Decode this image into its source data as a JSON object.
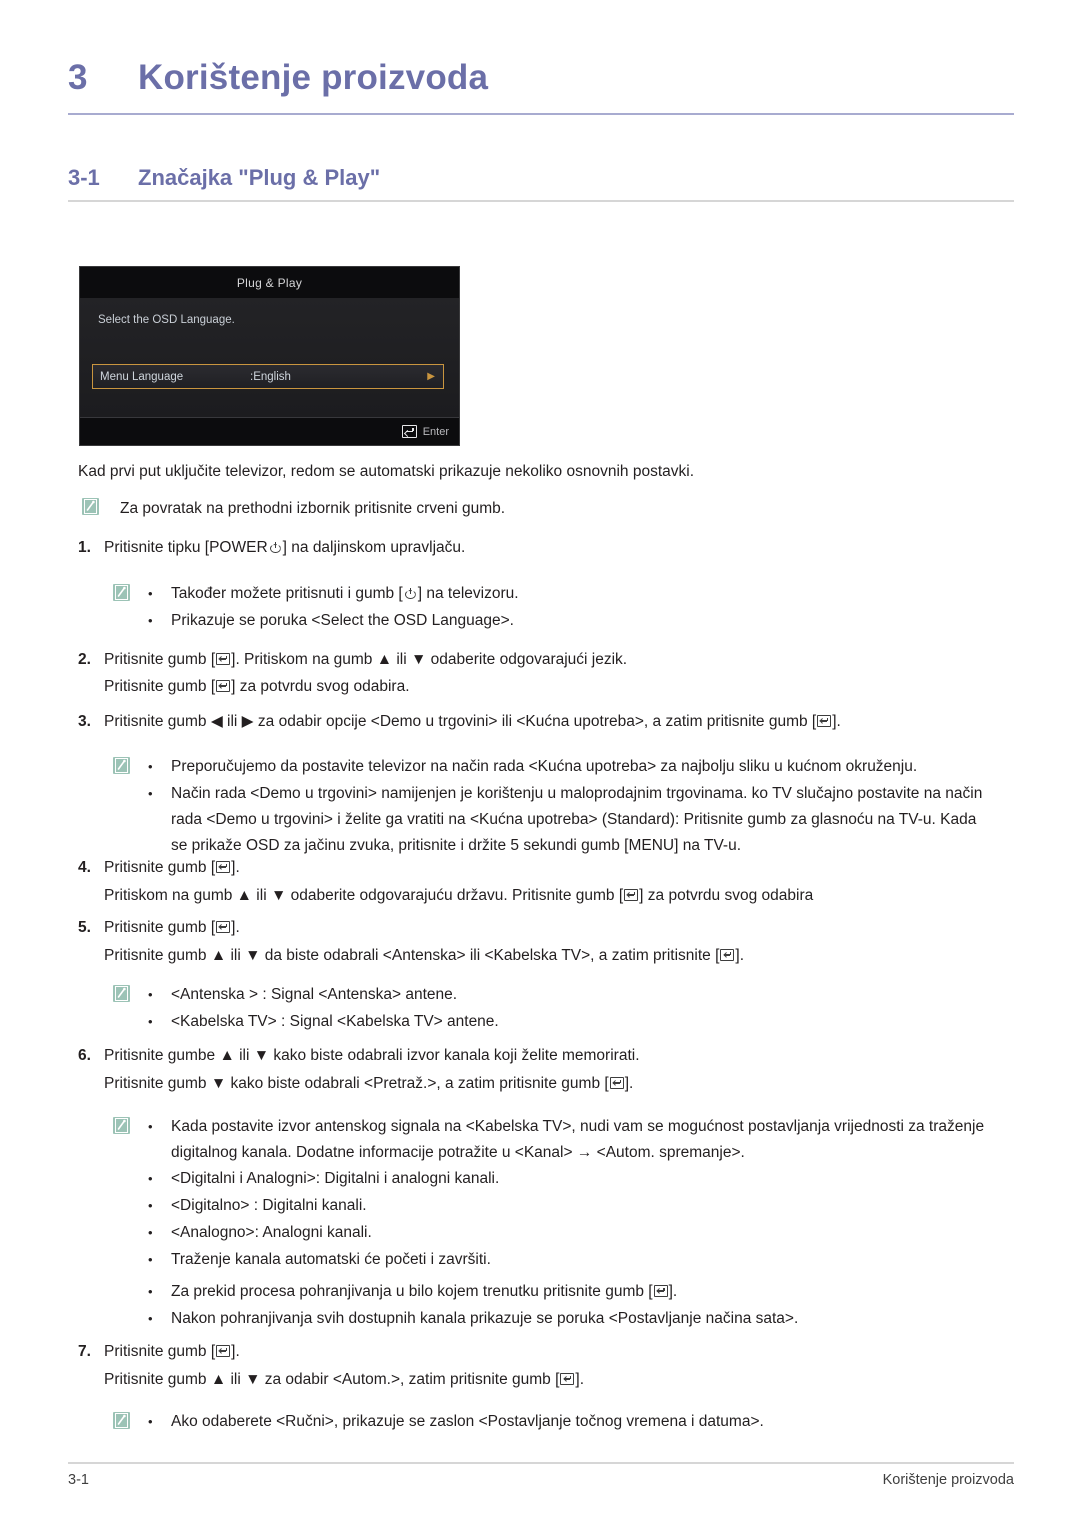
{
  "chapter": {
    "number": "3",
    "title": "Korištenje proizvoda"
  },
  "section": {
    "number": "3-1",
    "title": "Značajka \"Plug & Play\""
  },
  "osd": {
    "title": "Plug & Play",
    "prompt": "Select the OSD Language.",
    "row_label": "Menu Language",
    "row_value": ":English",
    "row_arrow": "▶",
    "enter_label": "Enter"
  },
  "intro": "Kad prvi put uključite televizor, redom se automatski prikazuje nekoliko osnovnih postavki.",
  "note_first": "Za povratak na prethodni izbornik pritisnite crveni gumb.",
  "steps": {
    "s1": {
      "num": "1.",
      "text_a": "Pritisnite tipku [POWER",
      "text_b": "] na daljinskom upravljaču.",
      "notes": [
        {
          "text_a": "Također možete pritisnuti i gumb [",
          "text_b": "] na televizoru."
        },
        {
          "text_a": "Prikazuje se poruka <Select the OSD Language>.",
          "text_b": ""
        }
      ]
    },
    "s2": {
      "num": "2.",
      "line1_a": "Pritisnite gumb [",
      "line1_b": "]. Pritiskom na gumb ▲ ili ▼ odaberite odgovarajući jezik.",
      "line2_a": "Pritisnite gumb [",
      "line2_b": "] za potvrdu svog odabira."
    },
    "s3": {
      "num": "3.",
      "text_a": "Pritisnite gumb ◀ ili ▶ za odabir opcije <Demo u trgovini> ili <Kućna upotreba>, a zatim pritisnite gumb [",
      "text_b": "].",
      "notes": [
        "Preporučujemo da postavite televizor na način rada <Kućna upotreba> za najbolju sliku u kućnom okruženju.",
        "Način rada <Demo u trgovini> namijenjen je korištenju u maloprodajnim trgovinama. ko TV slučajno postavite na način rada <Demo u trgovini> i želite ga vratiti na <Kućna upotreba> (Standard): Pritisnite gumb za glasnoću na TV-u. Kada se prikaže OSD za jačinu zvuka, pritisnite i držite 5 sekundi gumb [MENU] na TV-u."
      ]
    },
    "s4": {
      "num": "4.",
      "line1_a": "Pritisnite gumb [",
      "line1_b": "].",
      "line2_a": "Pritiskom na gumb ▲ ili ▼ odaberite odgovarajuću državu. Pritisnite gumb [",
      "line2_b": "] za potvrdu svog odabira"
    },
    "s5": {
      "num": "5.",
      "line1_a": "Pritisnite gumb [",
      "line1_b": "].",
      "line2_a": "Pritisnite gumb ▲ ili ▼ da biste odabrali <Antenska> ili <Kabelska TV>, a zatim pritisnite [",
      "line2_b": "].",
      "notes": [
        "<Antenska > : Signal <Antenska> antene.",
        "<Kabelska TV> : Signal <Kabelska TV> antene."
      ]
    },
    "s6": {
      "num": "6.",
      "line1": "Pritisnite gumbe ▲ ili ▼ kako biste odabrali izvor kanala koji želite memorirati.",
      "line2_a": "Pritisnite gumb ▼ kako biste odabrali <Pretraž.>, a zatim pritisnite gumb [",
      "line2_b": "].",
      "notes": [
        "Kada postavite izvor antenskog signala na <Kabelska TV>, nudi vam se mogućnost postavljanja vrijednosti za traženje digitalnog kanala. Dodatne informacije potražite u <Kanal> → <Autom. spremanje>.",
        "<Digitalni i Analogni>: Digitalni i analogni kanali.",
        "<Digitalno> : Digitalni kanali.",
        "<Analogno>: Analogni kanali.",
        "Traženje kanala automatski će početi i završiti."
      ],
      "note_enter_a": "Za prekid procesa pohranjivanja u bilo kojem trenutku pritisnite gumb [",
      "note_enter_b": "].",
      "note_last": "Nakon pohranjivanja svih dostupnih kanala prikazuje se poruka <Postavljanje načina sata>."
    },
    "s7": {
      "num": "7.",
      "line1_a": "Pritisnite gumb [",
      "line1_b": "].",
      "line2_a": "Pritisnite gumb ▲ ili ▼ za odabir <Autom.>, zatim pritisnite gumb [",
      "line2_b": "].",
      "note": "Ako odaberete <Ručni>, prikazuje se zaslon <Postavljanje točnog vremena i datuma>."
    }
  },
  "footer": {
    "left": "3-1",
    "right": "Korištenje proizvoda"
  },
  "colors": {
    "heading": "#6b6fa8",
    "chapter_rule": "#a8abd0",
    "section_rule": "#d6d6d6",
    "note_icon": "#9cc3b6",
    "osd_highlight": "#c9953f"
  }
}
